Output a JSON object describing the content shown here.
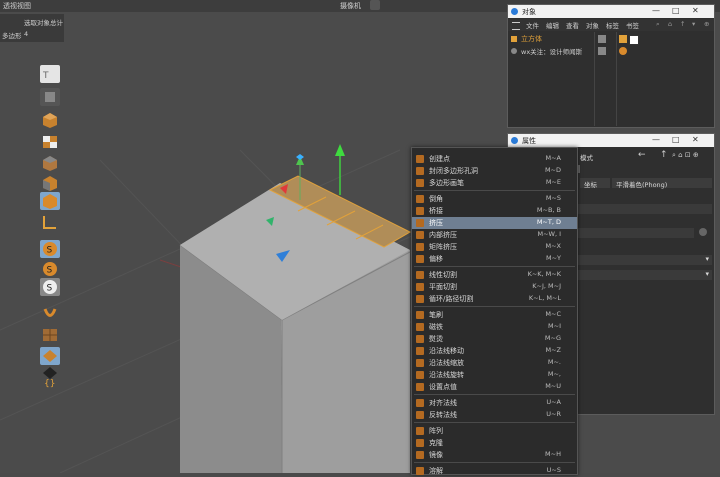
{
  "viewport": {
    "view_name": "透视视图",
    "camera_label": "摄像机",
    "hud": {
      "selection_label": "选取对象",
      "total_label": "总计",
      "poly_label": "多边形",
      "poly_count": "4"
    }
  },
  "toolbar_icons": [
    "texture-mode-icon",
    "object-mode-icon",
    "cube-icon",
    "checker-icon",
    "cube-icon",
    "cube-icon",
    "polygon-mode-icon",
    "edge-mode-icon",
    "snap-icon",
    "snap-icon",
    "snap-icon",
    "magnet-icon",
    "grid-icon",
    "grid-icon",
    "grid-icon",
    "brace-icon"
  ],
  "context_menu": [
    {
      "label": "创建点",
      "shortcut": "M~A",
      "highlight": false
    },
    {
      "label": "封闭多边形孔洞",
      "shortcut": "M~D",
      "highlight": false
    },
    {
      "label": "多边形画笔",
      "shortcut": "M~E",
      "highlight": false,
      "sep_after": true
    },
    {
      "label": "倒角",
      "shortcut": "M~S",
      "highlight": false
    },
    {
      "label": "桥接",
      "shortcut": "M~B, B",
      "highlight": false
    },
    {
      "label": "挤压",
      "shortcut": "M~T, D",
      "highlight": true
    },
    {
      "label": "内部挤压",
      "shortcut": "M~W, I",
      "highlight": false
    },
    {
      "label": "矩阵挤压",
      "shortcut": "M~X",
      "highlight": false
    },
    {
      "label": "偏移",
      "shortcut": "M~Y",
      "highlight": false,
      "sep_after": true
    },
    {
      "label": "线性切割",
      "shortcut": "K~K, M~K",
      "highlight": false
    },
    {
      "label": "平面切割",
      "shortcut": "K~J, M~J",
      "highlight": false
    },
    {
      "label": "循环/路径切割",
      "shortcut": "K~L, M~L",
      "highlight": false,
      "sep_after": true
    },
    {
      "label": "笔刷",
      "shortcut": "M~C",
      "highlight": false
    },
    {
      "label": "磁铁",
      "shortcut": "M~I",
      "highlight": false
    },
    {
      "label": "熨烫",
      "shortcut": "M~G",
      "highlight": false
    },
    {
      "label": "沿法线移动",
      "shortcut": "M~Z",
      "highlight": false
    },
    {
      "label": "沿法线缩放",
      "shortcut": "M~.",
      "highlight": false
    },
    {
      "label": "沿法线旋转",
      "shortcut": "M~,",
      "highlight": false
    },
    {
      "label": "设置点值",
      "shortcut": "M~U",
      "highlight": false,
      "sep_after": true
    },
    {
      "label": "对齐法线",
      "shortcut": "U~A",
      "highlight": false
    },
    {
      "label": "反转法线",
      "shortcut": "U~R",
      "highlight": false,
      "sep_after": true
    },
    {
      "label": "阵列",
      "shortcut": "",
      "highlight": false
    },
    {
      "label": "克隆",
      "shortcut": "",
      "highlight": false
    },
    {
      "label": "镜像",
      "shortcut": "M~H",
      "highlight": false,
      "sep_after": true
    },
    {
      "label": "溶解",
      "shortcut": "U~S",
      "highlight": false
    }
  ],
  "objects_window": {
    "title": "对象",
    "menu": [
      "文件",
      "编辑",
      "查看",
      "对象",
      "标签",
      "书签"
    ],
    "items": [
      "立方体",
      "wx关注：设计师闻斯"
    ]
  },
  "attributes_window": {
    "title": "属性",
    "mode_label": "模式",
    "tab_coords": "坐标",
    "tab_phong": "平滑着色(Phong)"
  },
  "colors": {
    "accent": "#e2a23a",
    "menu_highlight": "#6f7f92",
    "selection_orange": "#d8963b"
  }
}
